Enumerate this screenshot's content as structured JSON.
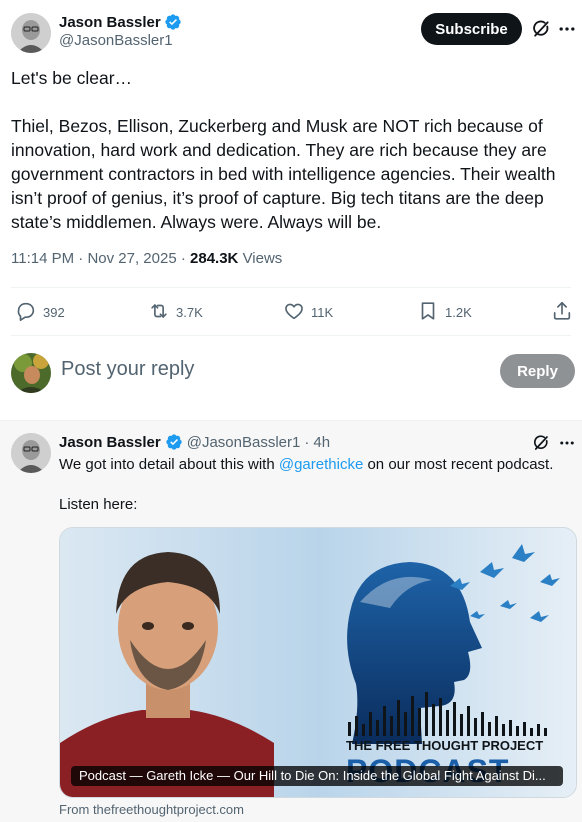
{
  "main_tweet": {
    "author_name": "Jason Bassler",
    "author_handle": "@JasonBassler1",
    "subscribe_label": "Subscribe",
    "paragraphs": [
      "Let's be clear…",
      "Thiel, Bezos, Ellison, Zuckerberg and Musk are NOT rich because of innovation, hard work and dedication. They are rich because they are government contractors in bed with intelligence agencies. Their wealth isn’t proof of genius, it’s proof of capture. Big tech titans are the deep state’s middlemen. Always were. Always will be."
    ],
    "time": "11:14 PM",
    "date": "Nov 27, 2025",
    "views_count": "284.3K",
    "views_label": "Views",
    "separator": "·"
  },
  "actions": {
    "replies": "392",
    "reposts": "3.7K",
    "likes": "11K",
    "bookmarks": "1.2K"
  },
  "reply_box": {
    "placeholder": "Post your reply",
    "button_label": "Reply"
  },
  "reply_tweet": {
    "author_name": "Jason Bassler",
    "author_handle": "@JasonBassler1",
    "dot": "·",
    "age": "4h",
    "text_before": "We got into detail about this with ",
    "mention": "@garethicke",
    "text_after": " on our most recent podcast.",
    "listen": "Listen here:",
    "card": {
      "caption": "Podcast — Gareth Icke — Our Hill to Die On: Inside the Global Fight Against Di...",
      "source": "From thefreethoughtproject.com",
      "logo_line1": "THE FREE THOUGHT PROJECT",
      "logo_line2": "PODCAST"
    }
  },
  "colors": {
    "accent": "#1d9bf0",
    "text": "#0f1419",
    "muted": "#536471",
    "reply_button": "#8e9295"
  }
}
